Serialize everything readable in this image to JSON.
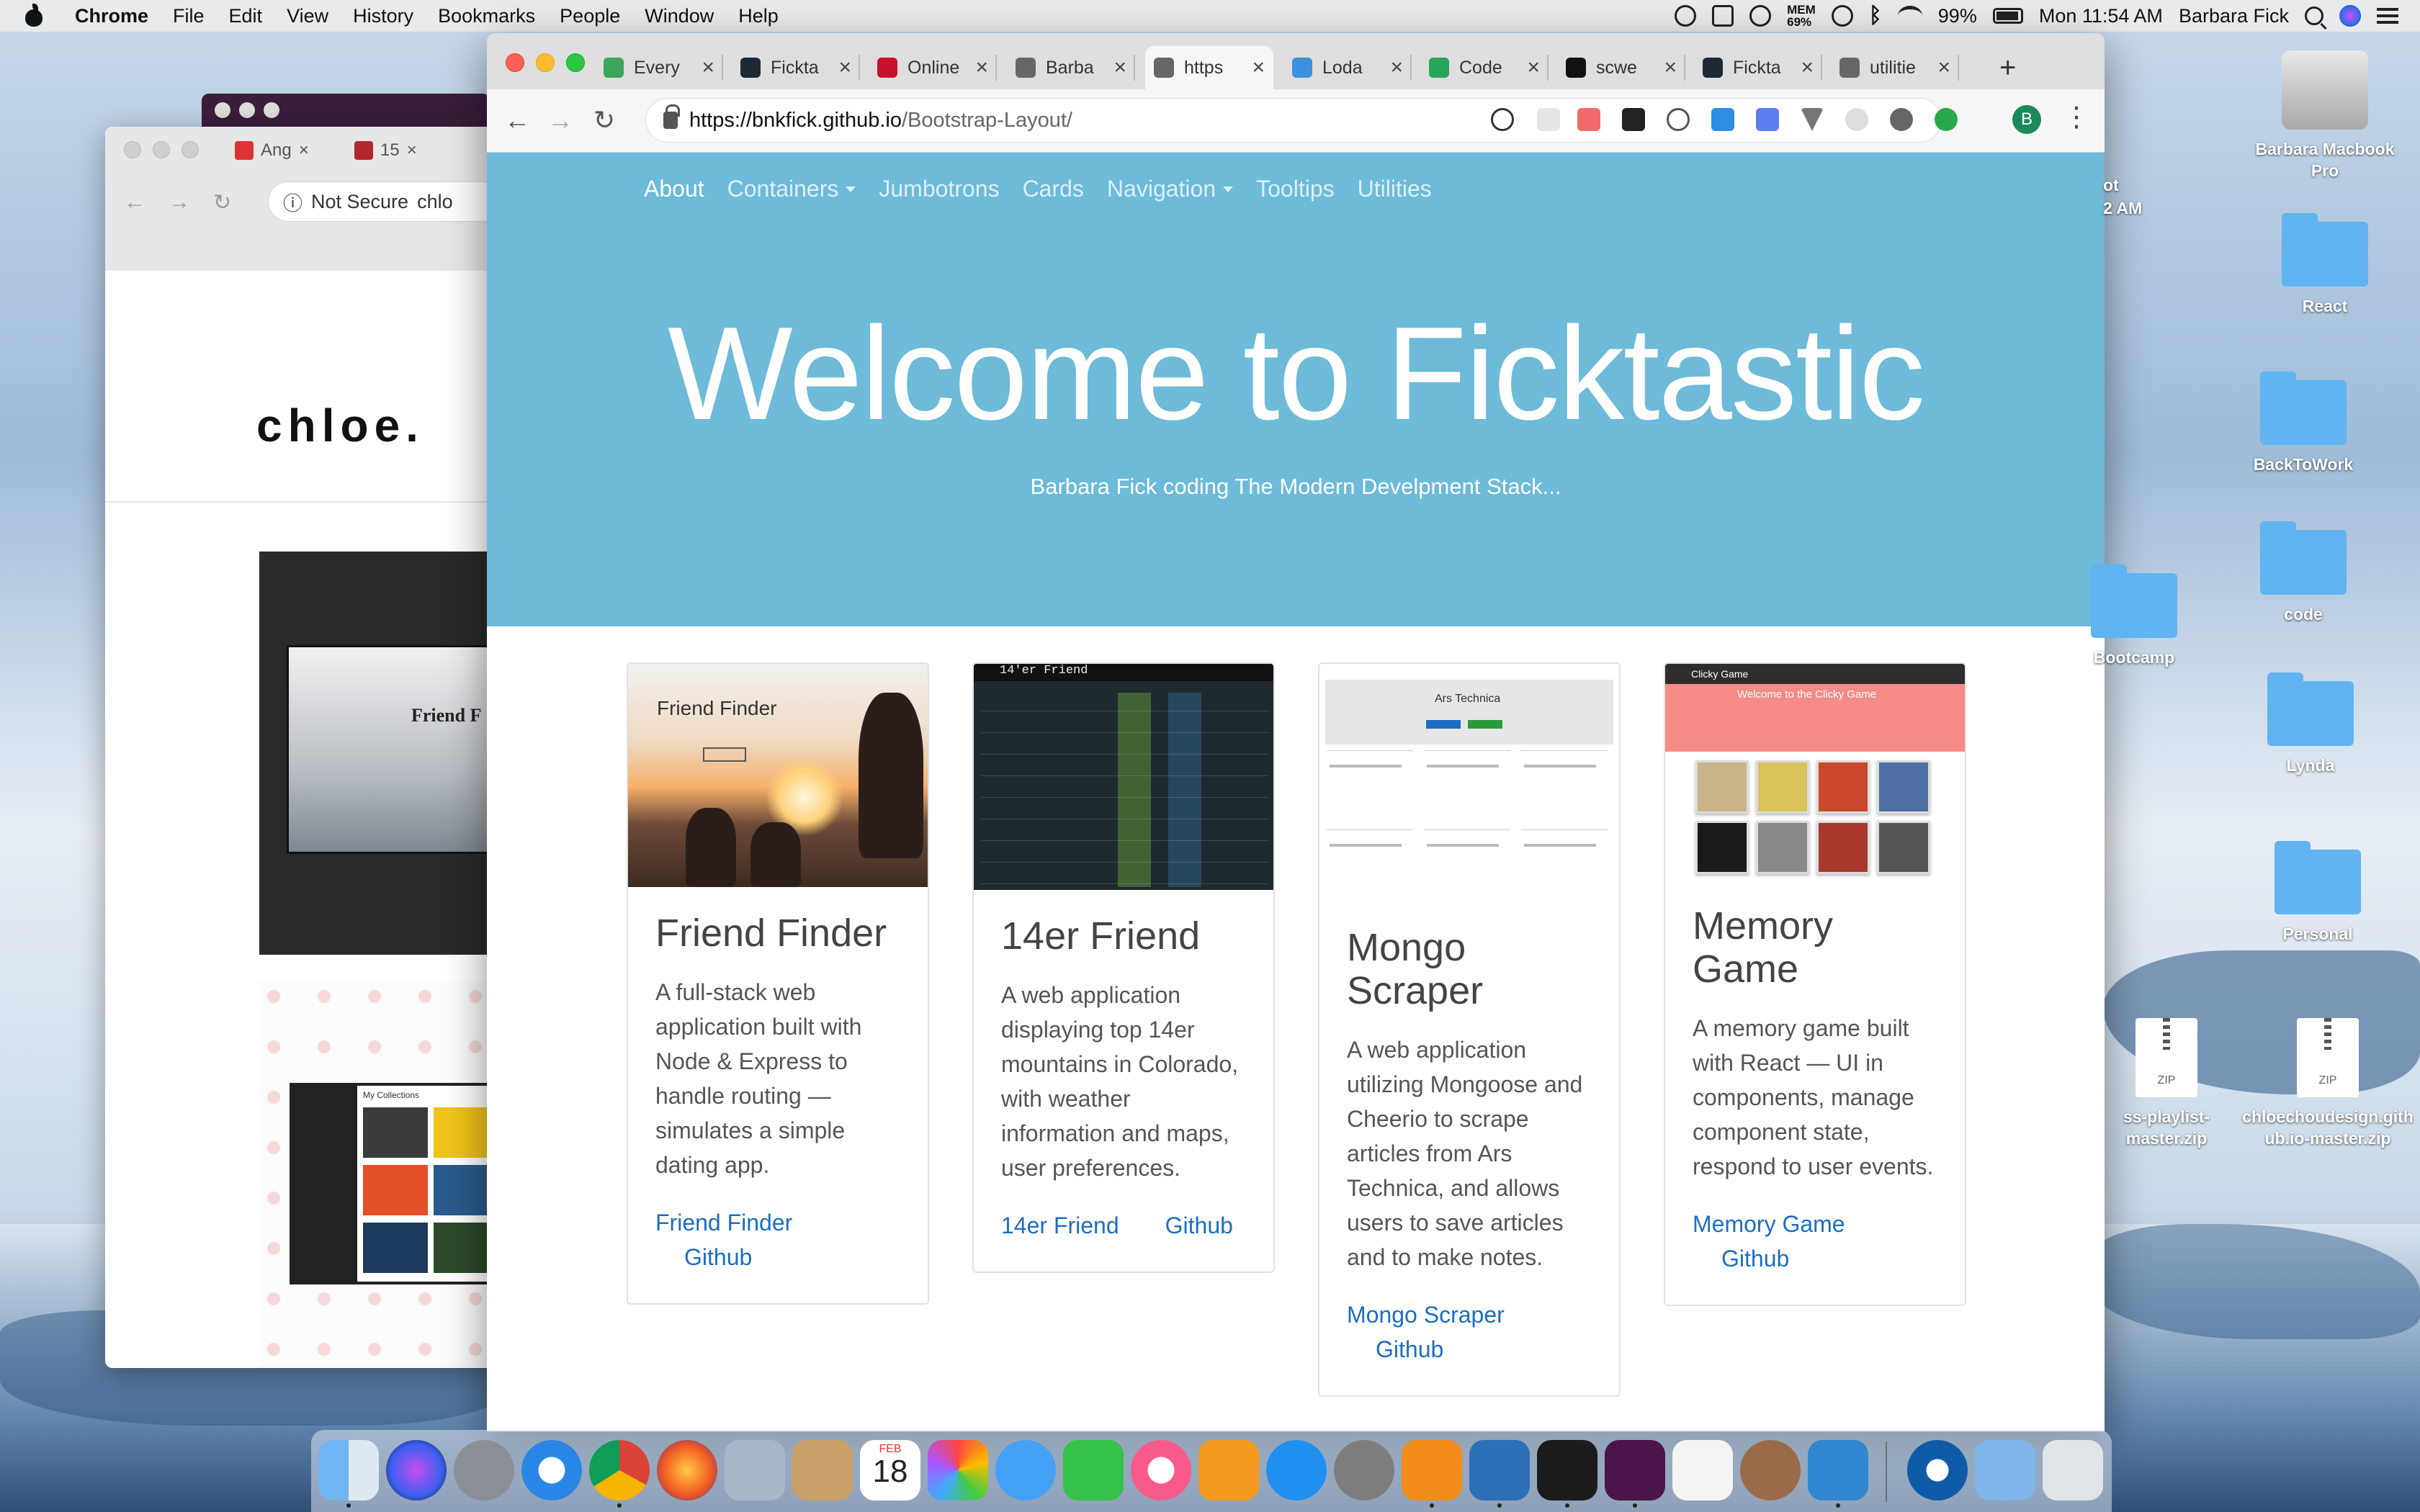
{
  "menubar": {
    "app": "Chrome",
    "items": [
      "File",
      "Edit",
      "View",
      "History",
      "Bookmarks",
      "People",
      "Window",
      "Help"
    ],
    "mem_label": "MEM",
    "mem_value": "69%",
    "battery": "99%",
    "clock": "Mon 11:54 AM",
    "user": "Barbara Fick"
  },
  "bg_window": {
    "tabs": [
      "Ang",
      "15"
    ],
    "not_secure": "Not Secure",
    "url": "chlo",
    "brand": "chloe.",
    "shot_title": "Friend F",
    "shot2_label": "My Collections"
  },
  "chrome": {
    "tabs": [
      {
        "title": "Every",
        "color": "#3ba55c"
      },
      {
        "title": "Fickta",
        "color": "#1d2a36"
      },
      {
        "title": "Online",
        "color": "#c8102e"
      },
      {
        "title": "Barba",
        "color": "#666666"
      },
      {
        "title": "https",
        "color": "#666666"
      },
      {
        "title": "Loda",
        "color": "#3c92dc"
      },
      {
        "title": "Code",
        "color": "#26a65b"
      },
      {
        "title": "scwe",
        "color": "#111111"
      },
      {
        "title": "Ficktа",
        "color": "#1d2a36"
      },
      {
        "title": "utilitie",
        "color": "#666666"
      }
    ],
    "url_host": "https://bnkfick.github.io",
    "url_path": "/Bootstrap-Layout/",
    "profile_initial": "B"
  },
  "site": {
    "nav": [
      {
        "label": "About",
        "active": true,
        "dropdown": false
      },
      {
        "label": "Containers",
        "active": false,
        "dropdown": true
      },
      {
        "label": "Jumbotrons",
        "active": false,
        "dropdown": false
      },
      {
        "label": "Cards",
        "active": false,
        "dropdown": false
      },
      {
        "label": "Navigation",
        "active": false,
        "dropdown": true
      },
      {
        "label": "Tooltips",
        "active": false,
        "dropdown": false
      },
      {
        "label": "Utilities",
        "active": false,
        "dropdown": false
      }
    ],
    "hero_title": "Welcome to Ficktastic",
    "hero_subtitle": "Barbara Fick coding The Modern Develpment Stack...",
    "hero_color": "#6dbad9",
    "link_color": "#1b6ec2"
  },
  "cards": [
    {
      "title": "Friend Finder",
      "thumb_label": "Friend Finder",
      "desc": "A full-stack web application built with Node & Express to handle routing — simulates a simple dating app.",
      "link1": "Friend Finder",
      "link2": "Github"
    },
    {
      "title": "14er Friend",
      "thumb_label": "14'er Friend",
      "desc": "A web application displaying top 14er mountains in Colorado, with weather information and maps, user preferences.",
      "link1": "14er Friend",
      "link2": "Github"
    },
    {
      "title": "Mongo Scraper",
      "thumb_label": "Ars Technica",
      "desc": "A web application utilizing Mongoose and Cheerio to scrape articles from Ars Technica, and allows users to save articles and to make notes.",
      "link1": "Mongo Scraper",
      "link2": "Github"
    },
    {
      "title": "Memory Game",
      "thumb_label": "Clicky Game",
      "thumb_banner": "Welcome to the Clicky Game",
      "desc": "A memory game built with React — UI in components, manage component state, respond to user events.",
      "link1": "Memory Game",
      "link2": "Github"
    }
  ],
  "desktop": {
    "items": [
      {
        "label": "Barbara Macbook Pro",
        "kind": "drive"
      },
      {
        "label": "React",
        "kind": "folder"
      },
      {
        "label": "BackToWork",
        "kind": "folder"
      },
      {
        "label": "code",
        "kind": "folder"
      },
      {
        "label": "Lynda",
        "kind": "folder"
      },
      {
        "label": "Personal",
        "kind": "folder"
      },
      {
        "label": "Bootcamp",
        "kind": "folder"
      },
      {
        "label": "ss-playlist-master.zip",
        "kind": "zip"
      },
      {
        "label": "chloechoudesign.github.io-master.zip",
        "kind": "zip"
      }
    ],
    "zip_badge": "ZIP",
    "peek_text": "ot",
    "peek_time": "2 AM"
  },
  "dock": {
    "calendar_month": "FEB",
    "calendar_day": "18"
  }
}
